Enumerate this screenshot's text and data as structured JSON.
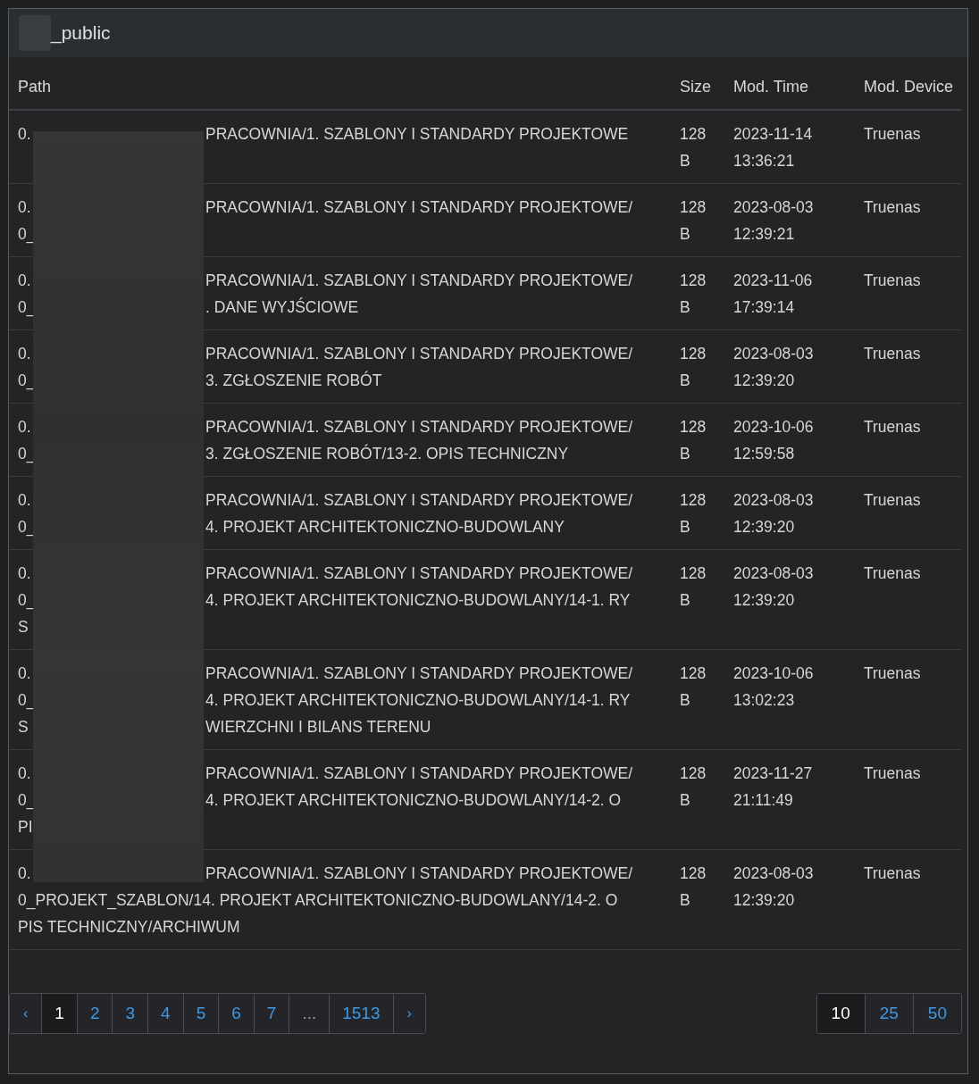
{
  "title": "_public",
  "columns": [
    "Path",
    "Size",
    "Mod. Time",
    "Mod. Device"
  ],
  "rows": [
    {
      "path": [
        {
          "prefix": "0.",
          "suffix": "PRACOWNIA/1. SZABLONY I STANDARDY PROJEKTOWE"
        }
      ],
      "size": "128 B",
      "time": "2023-11-14 13:36:21",
      "device": "Truenas"
    },
    {
      "path": [
        {
          "prefix": "0.",
          "suffix": "PRACOWNIA/1. SZABLONY I STANDARDY PROJEKTOWE/"
        },
        {
          "prefix": "0_"
        }
      ],
      "size": "128 B",
      "time": "2023-08-03 12:39:21",
      "device": "Truenas"
    },
    {
      "path": [
        {
          "prefix": "0.",
          "suffix": "PRACOWNIA/1. SZABLONY I STANDARDY PROJEKTOWE/"
        },
        {
          "prefix": "0_",
          "suffix": ". DANE WYJŚCIOWE"
        }
      ],
      "size": "128 B",
      "time": "2023-11-06 17:39:14",
      "device": "Truenas"
    },
    {
      "path": [
        {
          "prefix": "0.",
          "suffix": "PRACOWNIA/1. SZABLONY I STANDARDY PROJEKTOWE/"
        },
        {
          "prefix": "0_",
          "suffix": "3. ZGŁOSZENIE ROBÓT"
        }
      ],
      "size": "128 B",
      "time": "2023-08-03 12:39:20",
      "device": "Truenas"
    },
    {
      "path": [
        {
          "prefix": "0.",
          "suffix": "PRACOWNIA/1. SZABLONY I STANDARDY PROJEKTOWE/"
        },
        {
          "prefix": "0_",
          "suffix": "3. ZGŁOSZENIE ROBÓT/13-2. OPIS TECHNICZNY"
        }
      ],
      "size": "128 B",
      "time": "2023-10-06 12:59:58",
      "device": "Truenas"
    },
    {
      "path": [
        {
          "prefix": "0.",
          "suffix": "PRACOWNIA/1. SZABLONY I STANDARDY PROJEKTOWE/"
        },
        {
          "prefix": "0_",
          "suffix": "4. PROJEKT ARCHITEKTONICZNO-BUDOWLANY"
        }
      ],
      "size": "128 B",
      "time": "2023-08-03 12:39:20",
      "device": "Truenas"
    },
    {
      "path": [
        {
          "prefix": "0.",
          "suffix": "PRACOWNIA/1. SZABLONY I STANDARDY PROJEKTOWE/"
        },
        {
          "prefix": "0_",
          "suffix": "4. PROJEKT ARCHITEKTONICZNO-BUDOWLANY/14-1. RY"
        },
        {
          "prefix": "S"
        }
      ],
      "size": "128 B",
      "time": "2023-08-03 12:39:20",
      "device": "Truenas"
    },
    {
      "path": [
        {
          "prefix": "0.",
          "suffix": "PRACOWNIA/1. SZABLONY I STANDARDY PROJEKTOWE/"
        },
        {
          "prefix": "0_",
          "suffix": "4. PROJEKT ARCHITEKTONICZNO-BUDOWLANY/14-1. RY"
        },
        {
          "prefix": "S",
          "suffix": "WIERZCHNI I BILANS TERENU"
        }
      ],
      "size": "128 B",
      "time": "2023-10-06 13:02:23",
      "device": "Truenas"
    },
    {
      "path": [
        {
          "prefix": "0.",
          "suffix": "PRACOWNIA/1. SZABLONY I STANDARDY PROJEKTOWE/"
        },
        {
          "prefix": "0_",
          "suffix": "4. PROJEKT ARCHITEKTONICZNO-BUDOWLANY/14-2. O"
        },
        {
          "prefix": "PI"
        }
      ],
      "size": "128 B",
      "time": "2023-11-27 21:11:49",
      "device": "Truenas"
    },
    {
      "path": [
        {
          "prefix": "0.",
          "suffix": "PRACOWNIA/1. SZABLONY I STANDARDY PROJEKTOWE/"
        },
        {
          "text": "0_PROJEKT_SZABLON/14. PROJEKT ARCHITEKTONICZNO-BUDOWLANY/14-2. O"
        },
        {
          "text": "PIS TECHNICZNY/ARCHIWUM"
        }
      ],
      "size": "128 B",
      "time": "2023-08-03 12:39:20",
      "device": "Truenas"
    }
  ],
  "pagination": {
    "pages": [
      {
        "label": "‹",
        "kind": "nav",
        "selected": false
      },
      {
        "label": "1",
        "kind": "page",
        "selected": true
      },
      {
        "label": "2",
        "kind": "page",
        "selected": false
      },
      {
        "label": "3",
        "kind": "page",
        "selected": false
      },
      {
        "label": "4",
        "kind": "page",
        "selected": false
      },
      {
        "label": "5",
        "kind": "page",
        "selected": false
      },
      {
        "label": "6",
        "kind": "page",
        "selected": false
      },
      {
        "label": "7",
        "kind": "page",
        "selected": false
      },
      {
        "label": "...",
        "kind": "gap",
        "selected": false
      },
      {
        "label": "1513",
        "kind": "page",
        "selected": false
      },
      {
        "label": "›",
        "kind": "nav",
        "selected": false
      }
    ],
    "page_sizes": [
      {
        "label": "10",
        "selected": true
      },
      {
        "label": "25",
        "selected": false
      },
      {
        "label": "50",
        "selected": false
      }
    ]
  }
}
